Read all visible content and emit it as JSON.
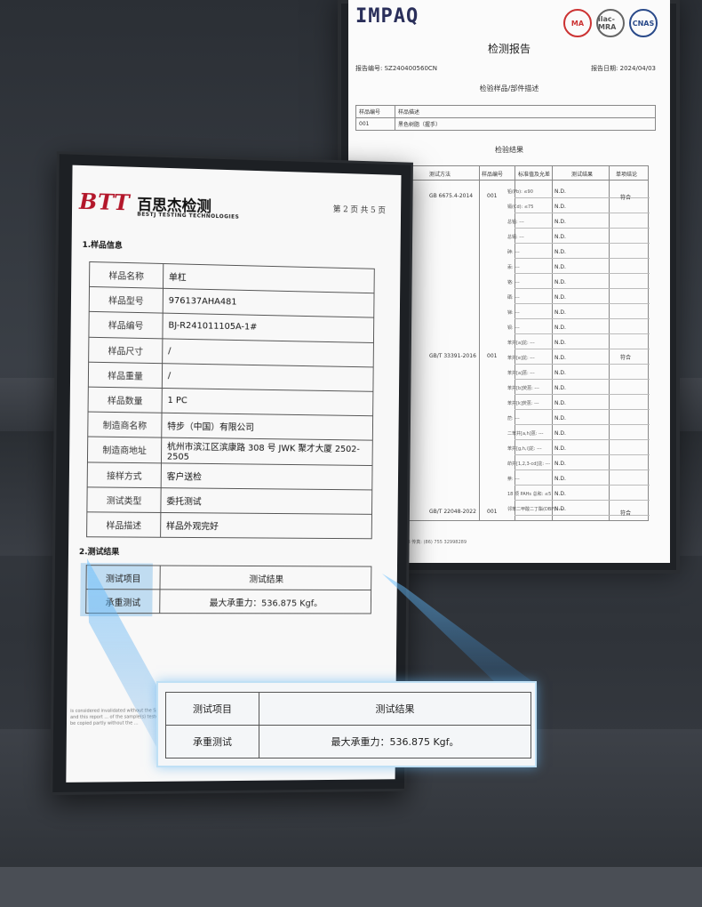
{
  "back_report": {
    "logo": "IMPAQ",
    "marks": [
      "MA",
      "ilac-MRA",
      "CNAS"
    ],
    "title": "检测报告",
    "report_no": "报告编号: SZ240400560CN",
    "report_date": "报告日期: 2024/04/03",
    "section_sample": "检验样品/部件描述",
    "sample_header": [
      "样品编号",
      "样品描述"
    ],
    "sample_row": [
      "001",
      "黑色树脂（握手）"
    ],
    "section_result": "检验结果",
    "result_headers": [
      "测试方法",
      "样品编号",
      "标准值及允差",
      "测试结果",
      "单项结论"
    ],
    "standards": [
      "GB 6675.4-2014",
      "GB/T 33391-2016",
      "GB/T 22048-2022"
    ],
    "sample_nums": [
      "001",
      "001",
      "001"
    ],
    "items": [
      "铅(Pb): ≤90",
      "镉(Cd): ≤75",
      "总铅: ---",
      "总镉: ---",
      "砷: ---",
      "汞: ---",
      "铬: ---",
      "硒: ---",
      "锑: ---",
      "钡: ---",
      "苯并[a]芘: ---",
      "苯并[e]芘: ---",
      "苯并[a]蒽: ---",
      "苯并[b]荧蒽: ---",
      "苯并[k]荧蒽: ---",
      "䓛: ---",
      "二苯并[a,h]蒽: ---",
      "苯并[g,h,i]苝: ---",
      "茚并[1,2,3-cd]芘: ---",
      "萘: ---",
      "18 项 PAHs 总和: ≤5",
      "邻苯二甲酸二丁酯(DBP): ---"
    ],
    "nd": "N.D.",
    "conclusion": "符合",
    "footer": "电话: (86) 755 32998288  传真: (86) 755 32998289"
  },
  "front_report": {
    "logo": "BTT",
    "logo_cn": "百思杰检测",
    "logo_en": "BESTJ TESTING TECHNOLOGIES",
    "page": "第 2 页 共 5 页",
    "section1": "1.样品信息",
    "sample_info": [
      {
        "label": "样品名称",
        "value": "单杠"
      },
      {
        "label": "样品型号",
        "value": "976137AHA481"
      },
      {
        "label": "样品编号",
        "value": "BJ-R241011105A-1#"
      },
      {
        "label": "样品尺寸",
        "value": "/"
      },
      {
        "label": "样品重量",
        "value": "/"
      },
      {
        "label": "样品数量",
        "value": "1 PC"
      },
      {
        "label": "制造商名称",
        "value": "特步（中国）有限公司"
      },
      {
        "label": "制造商地址",
        "value": "杭州市滨江区滨康路 308 号 JWK 聚才大厦 2502-2505"
      },
      {
        "label": "接样方式",
        "value": "客户送检"
      },
      {
        "label": "测试类型",
        "value": "委托测试"
      },
      {
        "label": "样品描述",
        "value": "样品外观完好"
      }
    ],
    "section2": "2.测试结果",
    "test_header": [
      "测试项目",
      "测试结果"
    ],
    "test_row": [
      "承重测试",
      "最大承重力：536.875 Kgf。"
    ],
    "fine_print": "is considered invalidated without the Special ... submitted by the customer, and this report ... of the sample(s) tested. The results in this report ... shall not be copied partly without the ..."
  },
  "zoom": {
    "header": [
      "测试项目",
      "测试结果"
    ],
    "row": [
      "承重测试",
      "最大承重力：536.875 Kgf。"
    ]
  }
}
